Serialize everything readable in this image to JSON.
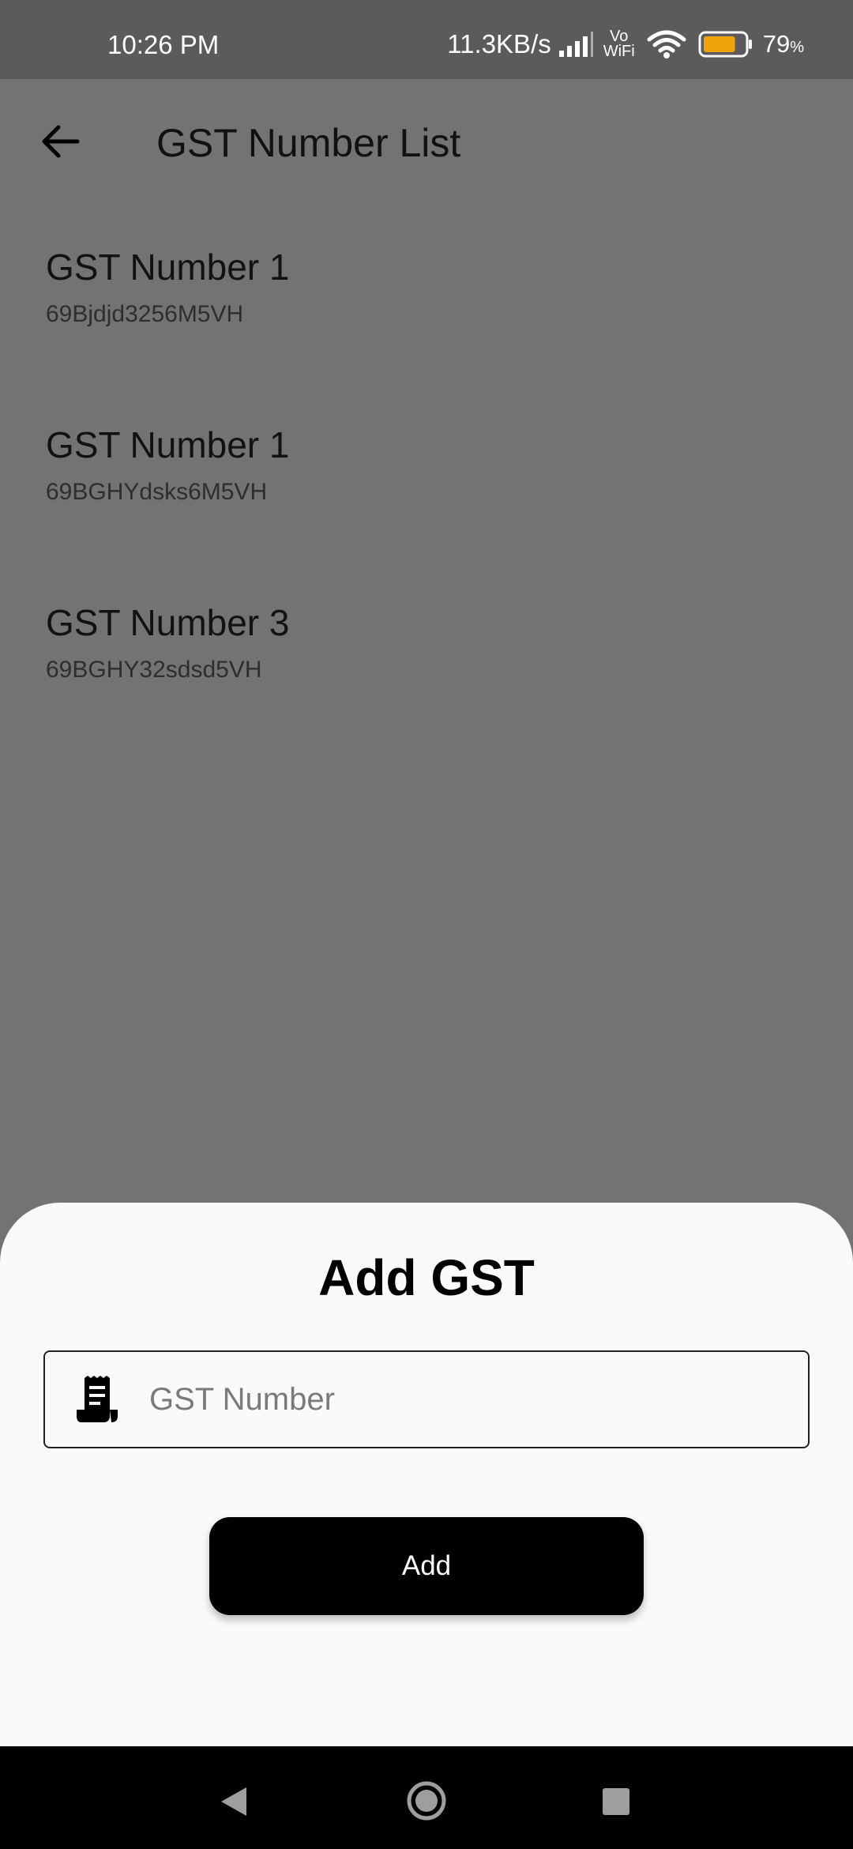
{
  "status_bar": {
    "time": "10:26 PM",
    "network_speed": "11.3KB/s",
    "vowifi_top": "Vo",
    "vowifi_bottom": "WiFi",
    "battery_value": "79",
    "battery_unit": "%",
    "battery_level": 0.79,
    "icons": [
      "signal-icon",
      "wifi-icon",
      "battery-icon"
    ]
  },
  "header": {
    "title": "GST Number List",
    "back_icon": "arrow-left-icon"
  },
  "gst_list": [
    {
      "name": "GST Number 1",
      "number": "69Bjdjd3256M5VH"
    },
    {
      "name": "GST Number 1",
      "number": "69BGHYdsks6M5VH"
    },
    {
      "name": "GST Number 3",
      "number": "69BGHY32sdsd5VH"
    }
  ],
  "add_sheet": {
    "title": "Add GST",
    "input_placeholder": "GST Number",
    "input_value": "",
    "input_icon": "receipt-icon",
    "add_label": "Add"
  },
  "nav_bar": {
    "icons": [
      "nav-back-icon",
      "nav-home-icon",
      "nav-recents-icon"
    ]
  },
  "colors": {
    "scrim": "#737373",
    "status_bar": "#5b5b5b",
    "sheet_background": "#fafafa",
    "primary_button": "#000000",
    "battery_fill": "#f0a30a"
  }
}
